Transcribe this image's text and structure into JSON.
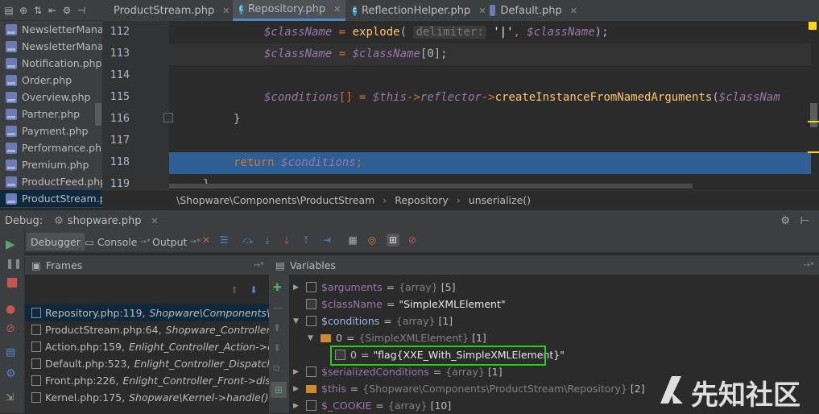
{
  "project_tree": {
    "items": [
      "NewsletterManager.php",
      "NewsletterManag",
      "Notification.php",
      "Order.php",
      "Overview.php",
      "Partner.php",
      "Payment.php",
      "Performance.php",
      "Premium.php",
      "ProductFeed.php",
      "ProductStream.pl"
    ],
    "selected_index": 10
  },
  "editor": {
    "tabs": [
      "ProductStream.php",
      "Repository.php",
      "ReflectionHelper.php",
      "Default.php"
    ],
    "active_tab_index": 1,
    "line_numbers": [
      "112",
      "113",
      "114",
      "115",
      "116",
      "117",
      "118",
      "119"
    ],
    "lines": {
      "l112": {
        "var1": "$className",
        "eq": " = ",
        "fn": "explode",
        "open": "(",
        "hint": "delimiter:",
        "str": "'|'",
        "comma": ", ",
        "var2": "$className",
        "close": ");"
      },
      "l113": {
        "var1": "$className",
        "eq": " = ",
        "var2": "$className",
        "idx": "[0];"
      },
      "l115": {
        "var1": "$conditions",
        "br": "[] = ",
        "this": "$this",
        "arrow1": "->",
        "prop": "reflector",
        "arrow2": "->",
        "fn": "createInstanceFromNamedArguments",
        "open": "(",
        "var2": "$classNam"
      },
      "l116": {
        "text": "}"
      },
      "l118": {
        "kw": "return ",
        "var": "$conditions",
        "semi": ";"
      },
      "l119": {
        "text": "}"
      }
    },
    "breadcrumbs": [
      "\\Shopware\\Components\\ProductStream",
      "Repository",
      "unserialize()"
    ]
  },
  "debug": {
    "label": "Debug:",
    "config": "shopware.php",
    "tabs": [
      "Debugger",
      "Console",
      "Output"
    ],
    "frames_title": "Frames",
    "variables_title": "Variables",
    "frames": [
      {
        "file": "Repository.php:119,",
        "ctx": "Shopware\\Components\\Pr"
      },
      {
        "file": "ProductStream.php:64,",
        "ctx": "Shopware_Controllers_B"
      },
      {
        "file": "Action.php:159,",
        "ctx": "Enlight_Controller_Action->disp"
      },
      {
        "file": "Default.php:523,",
        "ctx": "Enlight_Controller_Dispatcher_"
      },
      {
        "file": "Front.php:226,",
        "ctx": "Enlight_Controller_Front->dispat"
      },
      {
        "file": "Kernel.php:175,",
        "ctx": "Shopware\\Kernel->handle()"
      }
    ],
    "variables": [
      {
        "name": "$arguments",
        "eq": "=",
        "type": "{array}",
        "count": "[5]"
      },
      {
        "name": "$className",
        "eq": "=",
        "value": "\"SimpleXMLElement\""
      },
      {
        "name": "$conditions",
        "eq": "=",
        "type": "{array}",
        "count": "[1]"
      },
      {
        "name": "0",
        "eq": "=",
        "type": "{SimpleXMLElement}",
        "count": "[1]"
      },
      {
        "name": "0",
        "eq": "=",
        "value": "\"flag{XXE_With_SimpleXMLElement}\""
      },
      {
        "name": "$serializedConditions",
        "eq": "=",
        "type": "{array}",
        "count": "[1]"
      },
      {
        "name": "$this",
        "eq": "=",
        "type": "{Shopware\\Components\\ProductStream\\Repository}",
        "count": "[2]"
      },
      {
        "name": "$_COOKIE",
        "eq": "=",
        "type": "{array}",
        "count": "[10]"
      }
    ]
  },
  "watermark": {
    "text": "先知社区"
  },
  "colors": {
    "accent": "#4a88c7",
    "highlight_box": "#22d11a",
    "exec_line": "#2d5e94"
  }
}
